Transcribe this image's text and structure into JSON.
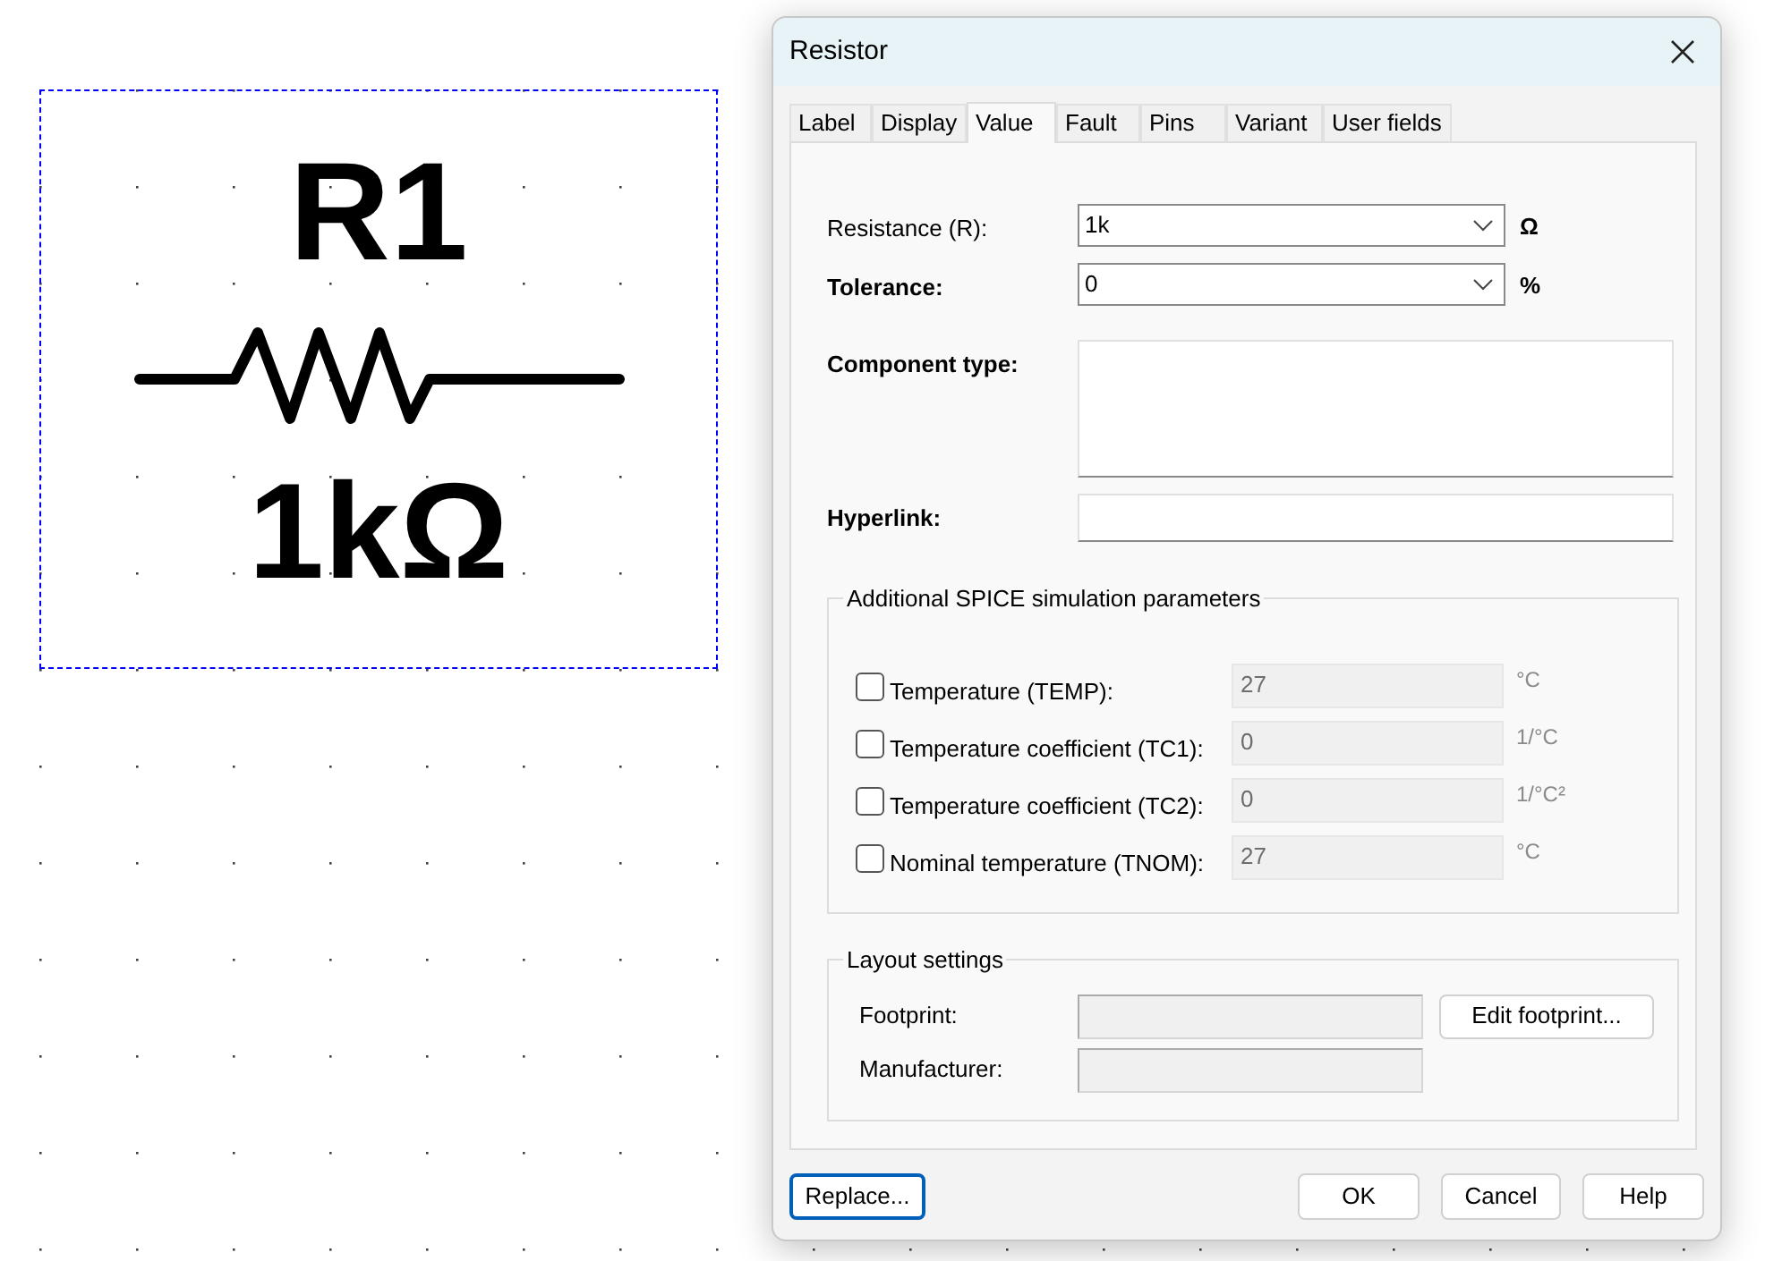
{
  "canvas": {
    "component": {
      "label": "R1",
      "value": "1kΩ",
      "selected": true
    }
  },
  "dialog": {
    "title": "Resistor",
    "tabs": [
      {
        "label": "Label",
        "selected": false
      },
      {
        "label": "Display",
        "selected": false
      },
      {
        "label": "Value",
        "selected": true
      },
      {
        "label": "Fault",
        "selected": false
      },
      {
        "label": "Pins",
        "selected": false
      },
      {
        "label": "Variant",
        "selected": false
      },
      {
        "label": "User fields",
        "selected": false
      }
    ],
    "fields": [
      {
        "kind": "combo",
        "label": "Resistance (R):",
        "bold": false,
        "value": "1k",
        "unit": "Ω"
      },
      {
        "kind": "combo",
        "label": "Tolerance:",
        "bold": true,
        "value": "0",
        "unit": "%"
      },
      {
        "kind": "multiline",
        "label": "Component type:",
        "bold": true
      },
      {
        "kind": "text",
        "label": "Hyperlink:",
        "bold": true
      }
    ],
    "spice": {
      "title": "Additional SPICE simulation parameters",
      "params": [
        {
          "label": "Temperature (TEMP):",
          "checked": false,
          "disabled": true,
          "value": "27",
          "unit": "°C"
        },
        {
          "label": "Temperature coefficient (TC1):",
          "checked": false,
          "disabled": true,
          "value": "0",
          "unit": "1/°C"
        },
        {
          "label": "Temperature coefficient (TC2):",
          "checked": false,
          "disabled": true,
          "value": "0",
          "unit": "1/°C²"
        },
        {
          "label": "Nominal temperature (TNOM):",
          "checked": false,
          "disabled": true,
          "value": "27",
          "unit": "°C"
        }
      ]
    },
    "layout": {
      "title": "Layout settings",
      "footprint_label": "Footprint:",
      "manufacturer_label": "Manufacturer:",
      "edit_button": "Edit footprint..."
    },
    "buttons": [
      {
        "label": "Replace...",
        "focused": true
      },
      {
        "label": "OK",
        "focused": false
      },
      {
        "label": "Cancel",
        "focused": false
      },
      {
        "label": "Help",
        "focused": false
      }
    ]
  }
}
